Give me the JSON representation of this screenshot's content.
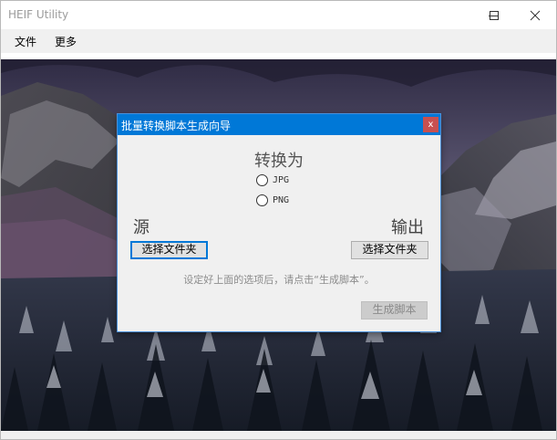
{
  "window": {
    "title": "HEIF Utility",
    "controls": [
      "minimize",
      "maximize",
      "close"
    ]
  },
  "menu": {
    "items": [
      {
        "label": "文件"
      },
      {
        "label": "更多"
      }
    ]
  },
  "dialog": {
    "title": "批量转换脚本生成向导",
    "close_label": "x",
    "convert_heading": "转换为",
    "formats": [
      {
        "label": "JPG",
        "selected": false
      },
      {
        "label": "PNG",
        "selected": false
      }
    ],
    "source": {
      "label": "源",
      "button": "选择文件夹"
    },
    "output": {
      "label": "输出",
      "button": "选择文件夹"
    },
    "hint": "设定好上面的选项后，请点击“生成脚本”。",
    "generate_button": "生成脚本",
    "generate_enabled": false
  },
  "colors": {
    "accent": "#0078d7",
    "dialog_close": "#c75050",
    "dialog_bg": "#f0f0f0"
  }
}
